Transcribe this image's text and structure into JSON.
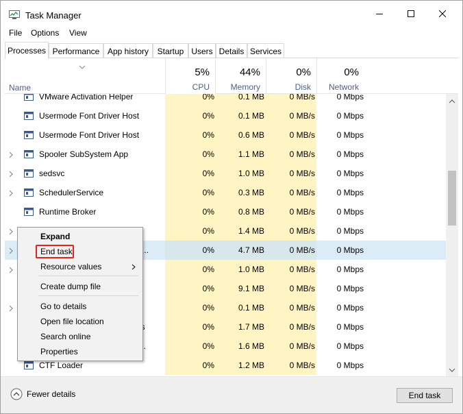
{
  "window": {
    "title": "Task Manager"
  },
  "menu": {
    "file": "File",
    "options": "Options",
    "view": "View"
  },
  "tabs": [
    "Processes",
    "Performance",
    "App history",
    "Startup",
    "Users",
    "Details",
    "Services"
  ],
  "header": {
    "name": "Name",
    "cpu_pct": "5%",
    "cpu": "CPU",
    "mem_pct": "44%",
    "mem": "Memory",
    "disk_pct": "0%",
    "disk": "Disk",
    "net_pct": "0%",
    "net": "Network"
  },
  "rows": [
    {
      "name": "VMware Activation Helper",
      "cpu": "0%",
      "mem": "0.1 MB",
      "disk": "0 MB/s",
      "net": "0 Mbps",
      "expand": false
    },
    {
      "name": "Usermode Font Driver Host",
      "cpu": "0%",
      "mem": "0.1 MB",
      "disk": "0 MB/s",
      "net": "0 Mbps",
      "expand": false
    },
    {
      "name": "Usermode Font Driver Host",
      "cpu": "0%",
      "mem": "0.6 MB",
      "disk": "0 MB/s",
      "net": "0 Mbps",
      "expand": false
    },
    {
      "name": "Spooler SubSystem App",
      "cpu": "0%",
      "mem": "1.1 MB",
      "disk": "0 MB/s",
      "net": "0 Mbps",
      "expand": true
    },
    {
      "name": "sedsvc",
      "cpu": "0%",
      "mem": "1.0 MB",
      "disk": "0 MB/s",
      "net": "0 Mbps",
      "expand": true
    },
    {
      "name": "SchedulerService",
      "cpu": "0%",
      "mem": "0.3 MB",
      "disk": "0 MB/s",
      "net": "0 Mbps",
      "expand": true
    },
    {
      "name": "Runtime Broker",
      "cpu": "0%",
      "mem": "0.8 MB",
      "disk": "0 MB/s",
      "net": "0 Mbps",
      "expand": false
    },
    {
      "name": "",
      "cpu": "0%",
      "mem": "1.4 MB",
      "disk": "0 MB/s",
      "net": "0 Mbps",
      "expand": true
    },
    {
      "name": "nde...",
      "cpu": "0%",
      "mem": "4.7 MB",
      "disk": "0 MB/s",
      "net": "0 Mbps",
      "expand": true,
      "selected": true
    },
    {
      "name": "",
      "cpu": "0%",
      "mem": "1.0 MB",
      "disk": "0 MB/s",
      "net": "0 Mbps",
      "expand": true
    },
    {
      "name": "",
      "cpu": "0%",
      "mem": "9.1 MB",
      "disk": "0 MB/s",
      "net": "0 Mbps",
      "expand": false
    },
    {
      "name": "cti...",
      "cpu": "0%",
      "mem": "0.1 MB",
      "disk": "0 MB/s",
      "net": "0 Mbps",
      "expand": true
    },
    {
      "name": "asks",
      "cpu": "0%",
      "mem": "1.7 MB",
      "disk": "0 MB/s",
      "net": "0 Mbps",
      "expand": false
    },
    {
      "name": "chr...",
      "cpu": "0%",
      "mem": "1.6 MB",
      "disk": "0 MB/s",
      "net": "0 Mbps",
      "expand": false
    },
    {
      "name": "CTF Loader",
      "cpu": "0%",
      "mem": "1.2 MB",
      "disk": "0 MB/s",
      "net": "0 Mbps",
      "expand": false
    }
  ],
  "context_menu": {
    "expand": "Expand",
    "end_task": "End task",
    "resource_values": "Resource values",
    "create_dump": "Create dump file",
    "go_to_details": "Go to details",
    "open_file_location": "Open file location",
    "search_online": "Search online",
    "properties": "Properties"
  },
  "footer": {
    "fewer_details": "Fewer details",
    "end_task": "End task"
  },
  "colors": {
    "heat": "#fff4c4",
    "selected": "#dcecf6",
    "highlight": "#e2231a",
    "header_label": "#4d6082"
  }
}
